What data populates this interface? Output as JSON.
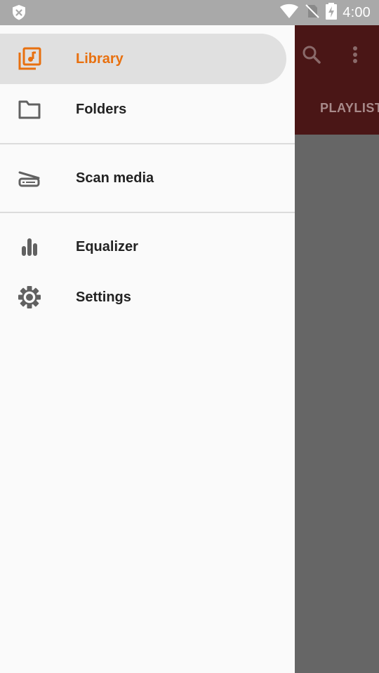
{
  "status_bar": {
    "time": "4:00",
    "icons": [
      "shield-notification-icon",
      "wifi-icon",
      "no-sim-icon",
      "battery-charging-icon"
    ]
  },
  "background_app": {
    "tab_label": "PLAYLIST",
    "icons": [
      "search-icon",
      "more-vert-icon"
    ],
    "colors": {
      "toolbar": "#4a1616",
      "scrim": "#666666"
    }
  },
  "drawer": {
    "items": [
      {
        "label": "Library",
        "icon": "library-music-icon",
        "active": true
      },
      {
        "label": "Folders",
        "icon": "folder-icon",
        "active": false
      },
      {
        "label": "Scan media",
        "icon": "scanner-icon",
        "active": false
      },
      {
        "label": "Equalizer",
        "icon": "equalizer-icon",
        "active": false
      },
      {
        "label": "Settings",
        "icon": "settings-gear-icon",
        "active": false
      }
    ],
    "colors": {
      "accent": "#e8700f",
      "active_bg": "#e0e0e0",
      "icon": "#616161"
    }
  }
}
